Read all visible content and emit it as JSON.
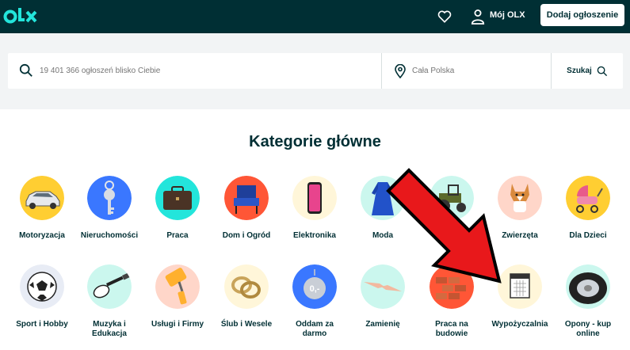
{
  "header": {
    "logo_text": "olx",
    "my_olx_label": "Mój OLX",
    "post_ad_label": "Dodaj ogłoszenie"
  },
  "search": {
    "query_placeholder": "19 401 366 ogłoszeń blisko Ciebie",
    "location_placeholder": "Cała Polska",
    "button_label": "Szukaj"
  },
  "main": {
    "title": "Kategorie główne",
    "categories_row1": [
      {
        "label": "Motoryzacja",
        "color": "#ffce32"
      },
      {
        "label": "Nieruchomości",
        "color": "#3a77ff"
      },
      {
        "label": "Praca",
        "color": "#23e5db"
      },
      {
        "label": "Dom i Ogród",
        "color": "#ff5636"
      },
      {
        "label": "Elektronika",
        "color": "#fff6d9"
      },
      {
        "label": "Moda",
        "color": "#cbf7ee"
      },
      {
        "label": "",
        "color": "#cbf7ee"
      },
      {
        "label": "Zwierzęta",
        "color": "#ffd6c9"
      },
      {
        "label": "Dla Dzieci",
        "color": "#ffce32"
      }
    ],
    "categories_row2": [
      {
        "label": "Sport i Hobby",
        "color": "#e8ecf5"
      },
      {
        "label": "Muzyka i\nEdukacja",
        "color": "#cbf7ee"
      },
      {
        "label": "Usługi i Firmy",
        "color": "#ffd6c9"
      },
      {
        "label": "Ślub i Wesele",
        "color": "#fff6d9"
      },
      {
        "label": "Oddam za\ndarmo",
        "color": "#3a77ff"
      },
      {
        "label": "Zamienię",
        "color": "#cbf7ee"
      },
      {
        "label": "Praca na\nbudowie",
        "color": "#ff5636"
      },
      {
        "label": "Wypożyczalnia",
        "color": "#fff6d9"
      },
      {
        "label": "Opony - kup\nonline",
        "color": "#cbf7ee"
      }
    ],
    "free_badge_text": "0,-"
  },
  "colors": {
    "brand_dark": "#002f34",
    "brand_teal": "#23e5db",
    "arrow_red": "#e8181b"
  }
}
